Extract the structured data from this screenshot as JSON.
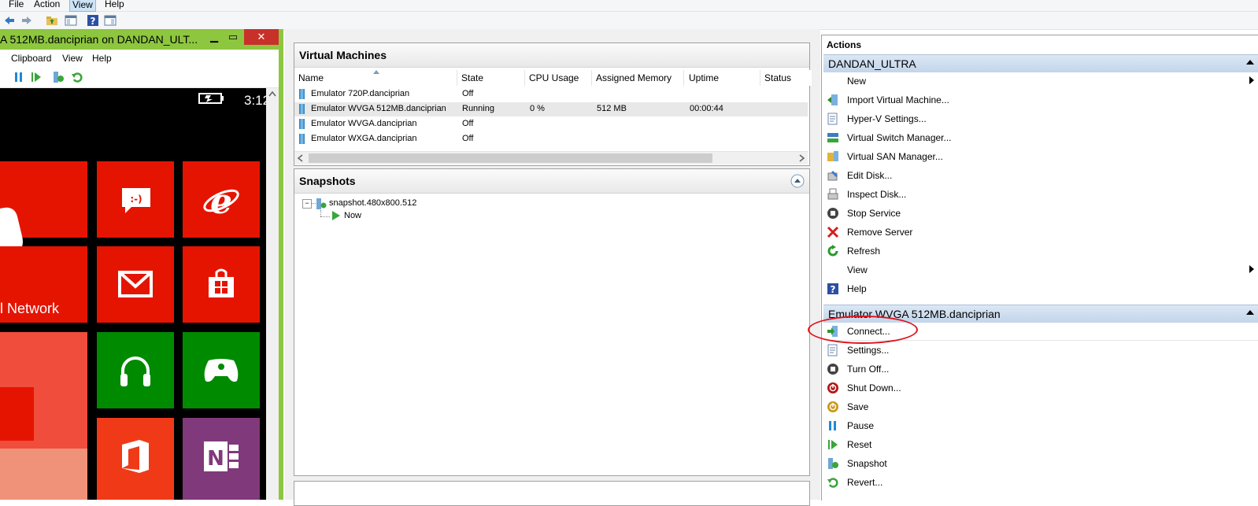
{
  "main_menu": {
    "file": "File",
    "action": "Action",
    "view": "View",
    "help": "Help"
  },
  "emulator": {
    "title": "A 512MB.danciprian on DANDAN_ULT...",
    "menu": {
      "clipboard": "Clipboard",
      "view": "View",
      "help": "Help"
    },
    "phone": {
      "time": "3:12",
      "network_label": "l Network",
      "colors": {
        "red": "#e51400",
        "green": "#008a00",
        "orange": "#f03a17",
        "purple": "#80397b",
        "salmon": "#f0917a"
      }
    }
  },
  "virtual_machines": {
    "title": "Virtual Machines",
    "columns": [
      "Name",
      "State",
      "CPU Usage",
      "Assigned Memory",
      "Uptime",
      "Status"
    ],
    "rows": [
      {
        "name": "Emulator 720P.danciprian",
        "state": "Off",
        "cpu": "",
        "memory": "",
        "uptime": "",
        "status": ""
      },
      {
        "name": "Emulator WVGA 512MB.danciprian",
        "state": "Running",
        "cpu": "0 %",
        "memory": "512 MB",
        "uptime": "00:00:44",
        "status": ""
      },
      {
        "name": "Emulator WVGA.danciprian",
        "state": "Off",
        "cpu": "",
        "memory": "",
        "uptime": "",
        "status": ""
      },
      {
        "name": "Emulator WXGA.danciprian",
        "state": "Off",
        "cpu": "",
        "memory": "",
        "uptime": "",
        "status": ""
      }
    ]
  },
  "snapshots": {
    "title": "Snapshots",
    "root": "snapshot.480x800.512",
    "child": "Now"
  },
  "actions": {
    "title": "Actions",
    "server_section": "DANDAN_ULTRA",
    "server_items": [
      {
        "label": "New",
        "icon": "none",
        "submenu": true
      },
      {
        "label": "Import Virtual Machine...",
        "icon": "import-icon"
      },
      {
        "label": "Hyper-V Settings...",
        "icon": "settings-icon"
      },
      {
        "label": "Virtual Switch Manager...",
        "icon": "switch-icon"
      },
      {
        "label": "Virtual SAN Manager...",
        "icon": "san-icon"
      },
      {
        "label": "Edit Disk...",
        "icon": "edit-disk-icon"
      },
      {
        "label": "Inspect Disk...",
        "icon": "inspect-disk-icon"
      },
      {
        "label": "Stop Service",
        "icon": "stop-icon"
      },
      {
        "label": "Remove Server",
        "icon": "remove-icon"
      },
      {
        "label": "Refresh",
        "icon": "refresh-icon"
      },
      {
        "label": "View",
        "icon": "none",
        "submenu": true
      },
      {
        "label": "Help",
        "icon": "help-icon"
      }
    ],
    "vm_section": "Emulator WVGA 512MB.danciprian",
    "vm_items": [
      {
        "label": "Connect...",
        "icon": "connect-icon"
      },
      {
        "label": "Settings...",
        "icon": "settings-icon"
      },
      {
        "label": "Turn Off...",
        "icon": "turn-off-icon"
      },
      {
        "label": "Shut Down...",
        "icon": "shutdown-icon"
      },
      {
        "label": "Save",
        "icon": "save-icon"
      },
      {
        "label": "Pause",
        "icon": "pause-icon"
      },
      {
        "label": "Reset",
        "icon": "reset-icon"
      },
      {
        "label": "Snapshot",
        "icon": "snapshot-icon"
      },
      {
        "label": "Revert...",
        "icon": "revert-icon"
      }
    ]
  }
}
